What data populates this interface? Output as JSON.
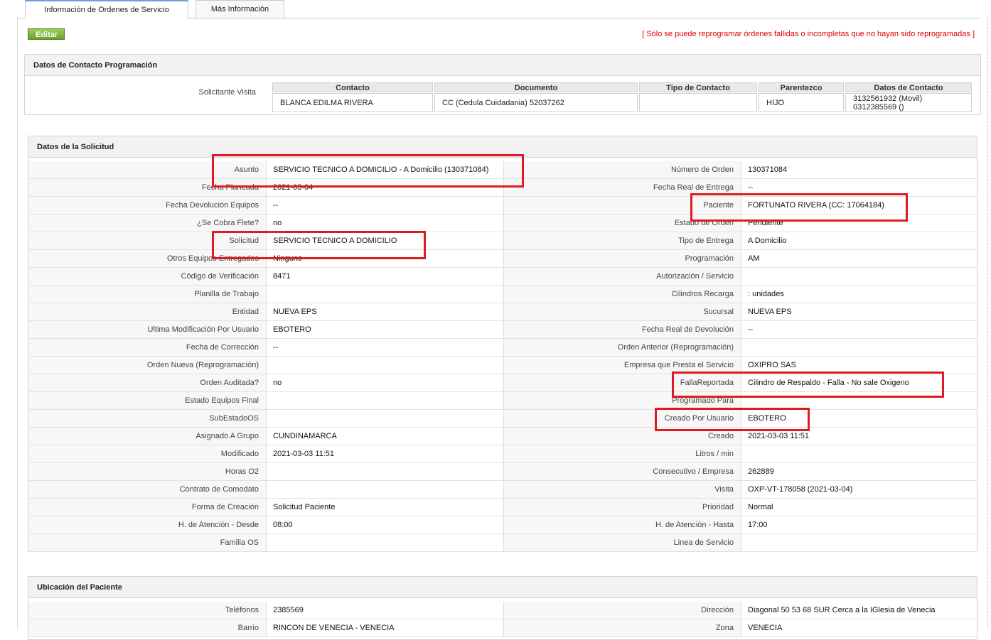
{
  "tabs": [
    {
      "label": "Información de Ordenes de Servicio"
    },
    {
      "label": "Más Información"
    }
  ],
  "toolbar": {
    "edit_label": "Editar",
    "warning": "[ Sólo se puede reprogramar órdenes fallidas o incompletas que no hayan sido reprogramadas ]"
  },
  "contact": {
    "title": "Datos de Contacto Programación",
    "row_label": "Solicitante Visita",
    "headers": [
      "Contacto",
      "Documento",
      "Tipo de Contacto",
      "Parentezco",
      "Datos de Contacto"
    ],
    "values": [
      "BLANCA EDILMA RIVERA",
      "CC (Cedula Cuidadania) 52037262",
      "",
      "HIJO"
    ],
    "phones": [
      "3132561932 (Movil)",
      "0312385569 ()"
    ]
  },
  "request": {
    "title": "Datos de la Solicitud",
    "rows": [
      {
        "l1": "Asunto",
        "v1": "SERVICIO TECNICO A DOMICILIO - A Domicilio (130371084)",
        "l2": "Número de Orden",
        "v2": "130371084"
      },
      {
        "l1": "Fecha Planeada",
        "v1": "2021-03-04",
        "l2": "Fecha Real de Entrega",
        "v2": "--"
      },
      {
        "l1": "Fecha Devolución Equipos",
        "v1": "--",
        "l2": "Paciente",
        "v2": "FORTUNATO RIVERA (CC: 17064184)"
      },
      {
        "l1": "¿Se Cobra Flete?",
        "v1": "no",
        "l2": "Estado de Orden",
        "v2": "Pendiente"
      },
      {
        "l1": "Solicitud",
        "v1": "SERVICIO TECNICO A DOMICILIO",
        "l2": "Tipo de Entrega",
        "v2": "A Domicilio"
      },
      {
        "l1": "Otros Equipos Entregados",
        "v1": "Ninguno",
        "l2": "Programación",
        "v2": "AM"
      },
      {
        "l1": "Código de Verificación",
        "v1": "8471",
        "l2": "Autorización / Servicio",
        "v2": ""
      },
      {
        "l1": "Planilla de Trabajo",
        "v1": "",
        "l2": "Cilindros Recarga",
        "v2": ": unidades"
      },
      {
        "l1": "Entidad",
        "v1": "NUEVA EPS",
        "l2": "Sucursal",
        "v2": "NUEVA EPS"
      },
      {
        "l1": "Ultima Modificación Por Usuario",
        "v1": "EBOTERO",
        "l2": "Fecha Real de Devolución",
        "v2": "--"
      },
      {
        "l1": "Fecha de Corrección",
        "v1": "--",
        "l2": "Orden Anterior (Reprogramación)",
        "v2": ""
      },
      {
        "l1": "Orden Nueva (Reprogramación)",
        "v1": "",
        "l2": "Empresa que Presta el Servicio",
        "v2": "OXIPRO SAS"
      },
      {
        "l1": "Orden Auditada?",
        "v1": "no",
        "l2": "FallaReportada",
        "v2": "Cilindro de Respaldo - Falla - No sale Oxigeno"
      },
      {
        "l1": "Estado Equipos Final",
        "v1": "",
        "l2": "Programado Para",
        "v2": ""
      },
      {
        "l1": "SubEstadoOS",
        "v1": "",
        "l2": "Creado Por Usuario",
        "v2": "EBOTERO"
      },
      {
        "l1": "Asignado A Grupo",
        "v1": "CUNDINAMARCA",
        "l2": "Creado",
        "v2": "2021-03-03 11:51"
      },
      {
        "l1": "Modificado",
        "v1": "2021-03-03 11:51",
        "l2": "Litros / min",
        "v2": ""
      },
      {
        "l1": "Horas O2",
        "v1": "",
        "l2": "Consecutivo / Empresa",
        "v2": "262889"
      },
      {
        "l1": "Contrato de Comodato",
        "v1": "",
        "l2": "Visita",
        "v2": "OXP-VT-178058 (2021-03-04)"
      },
      {
        "l1": "Forma de Creación",
        "v1": "Solicitud Paciente",
        "l2": "Prioridad",
        "v2": "Normal"
      },
      {
        "l1": "H. de Atención - Desde",
        "v1": "08:00",
        "l2": "H. de Atención - Hasta",
        "v2": "17:00"
      },
      {
        "l1": "Familia OS",
        "v1": "",
        "l2": "Linea de Servicio",
        "v2": ""
      }
    ]
  },
  "location": {
    "title": "Ubicación del Paciente",
    "rows": [
      {
        "l1": "Teléfonos",
        "v1": "2385569",
        "l2": "Dirección",
        "v2": "Diagonal 50 53 68 SUR Cerca a la IGlesia de Venecia"
      },
      {
        "l1": "Barrio",
        "v1": "RINCON DE VENECIA - VENECIA",
        "l2": "Zona",
        "v2": "VENECIA"
      }
    ]
  },
  "colors": {
    "highlight": "#e01a22",
    "edit_button": "#7ab53a",
    "warning": "#e00000"
  }
}
